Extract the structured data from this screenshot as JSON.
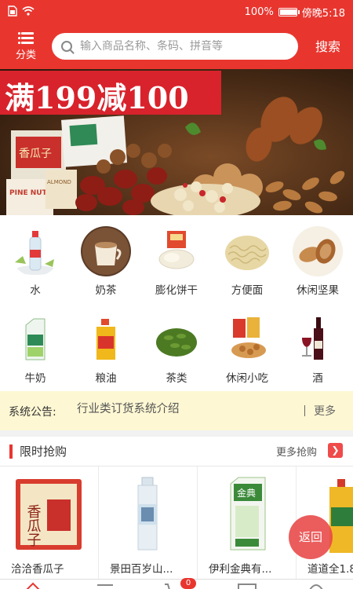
{
  "status_bar": {
    "battery": "100%",
    "time": "傍晚5:18"
  },
  "header": {
    "category_label": "分类",
    "search_placeholder": "输入商品名称、条码、拼音等",
    "search_button": "搜索"
  },
  "banner": {
    "promo_text": "满199减100",
    "package_labels": [
      "PINE NUT",
      "ALMOND",
      "香瓜子"
    ]
  },
  "categories": [
    {
      "label": "水",
      "icon": "water-bottle-icon"
    },
    {
      "label": "奶茶",
      "icon": "milk-tea-icon"
    },
    {
      "label": "膨化饼干",
      "icon": "biscuit-icon"
    },
    {
      "label": "方便面",
      "icon": "noodles-icon"
    },
    {
      "label": "休闲坚果",
      "icon": "nuts-icon"
    },
    {
      "label": "牛奶",
      "icon": "milk-carton-icon"
    },
    {
      "label": "粮油",
      "icon": "cooking-oil-icon"
    },
    {
      "label": "茶类",
      "icon": "tea-leaves-icon"
    },
    {
      "label": "休闲小吃",
      "icon": "snacks-icon"
    },
    {
      "label": "酒",
      "icon": "wine-icon"
    }
  ],
  "notice": {
    "label": "系统公告:",
    "text": "行业类订货系统介绍",
    "more": "更多"
  },
  "flash_sale": {
    "title": "限时抢购",
    "more": "更多抢购",
    "products": [
      {
        "name": "洽洽香瓜子",
        "pack_text": "香瓜子"
      },
      {
        "name": "景田百岁山...",
        "pack_text": ""
      },
      {
        "name": "伊利金典有...",
        "pack_text": "金典"
      },
      {
        "name": "道道全1.8"
      }
    ]
  },
  "floating": {
    "back_label": "返回"
  },
  "tab_bar": {
    "cart_badge": "0"
  },
  "colors": {
    "brand_red": "#e8362f",
    "notice_bg": "#fdf7d3"
  }
}
